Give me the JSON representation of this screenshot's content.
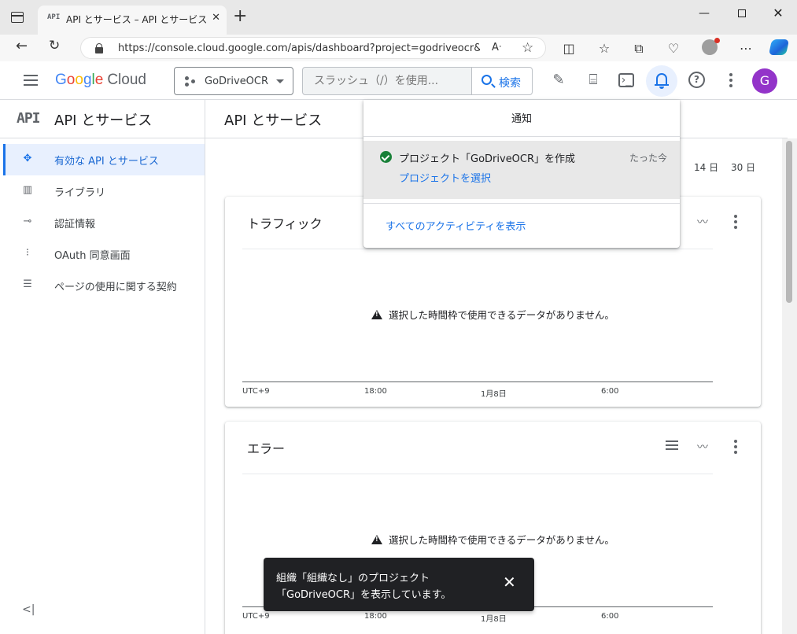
{
  "browser": {
    "tab_favicon": "API",
    "tab_title": "API とサービス – API とサービス – GoDriveOCR",
    "url": "https://console.cloud.google.com/apis/dashboard?project=godriveocr&...",
    "read_aloud_glyph": "Aᐧ",
    "tab_close": "✕",
    "new_tab": "+",
    "window": {
      "minimize": "—",
      "close": "✕"
    }
  },
  "header": {
    "logo_letters": [
      "G",
      "o",
      "o",
      "g",
      "l",
      "e"
    ],
    "logo_product": "Cloud",
    "project": "GoDriveOCR",
    "search_placeholder": "スラッシュ（/）を使用...",
    "search_button": "検索",
    "avatar_initial": "G"
  },
  "sidebar": {
    "mark": "API",
    "title": "API とサービス",
    "items": [
      {
        "label": "有効な API とサービス",
        "icon": "diamond-dots-icon",
        "glyph": "✥",
        "active": true
      },
      {
        "label": "ライブラリ",
        "icon": "library-icon",
        "glyph": "▥",
        "active": false
      },
      {
        "label": "認証情報",
        "icon": "key-icon",
        "glyph": "⊸",
        "active": false
      },
      {
        "label": "OAuth 同意画面",
        "icon": "consent-icon",
        "glyph": "⁝",
        "active": false
      },
      {
        "label": "ページの使用に関する契約",
        "icon": "settings-list-icon",
        "glyph": "☰",
        "active": false
      }
    ],
    "collapse": "<|"
  },
  "main": {
    "title": "API とサービス",
    "ranges": [
      "14 日",
      "30 日"
    ],
    "cards": [
      {
        "title": "トラフィック",
        "empty": "選択した時間枠で使用できるデータがありません。",
        "axis": [
          "UTC+9",
          "18:00",
          "1月8日",
          "6:00"
        ]
      },
      {
        "title": "エラー",
        "empty": "選択した時間枠で使用できるデータがありません。",
        "axis": [
          "UTC+9",
          "18:00",
          "1月8日",
          "6:00"
        ]
      }
    ]
  },
  "notifications": {
    "title": "通知",
    "items": [
      {
        "message": "プロジェクト「GoDriveOCR」を作成",
        "time": "たった今",
        "link": "プロジェクトを選択"
      }
    ],
    "view_all": "すべてのアクティビティを表示"
  },
  "snackbar": {
    "line1": "組織「組織なし」のプロジェクト",
    "line2": "「GoDriveOCR」を表示しています。",
    "close": "✕"
  },
  "colors": {
    "accent": "#1a73e8",
    "active_bg": "#e8f0fe",
    "success": "#188038",
    "avatar": "#9334c9"
  }
}
